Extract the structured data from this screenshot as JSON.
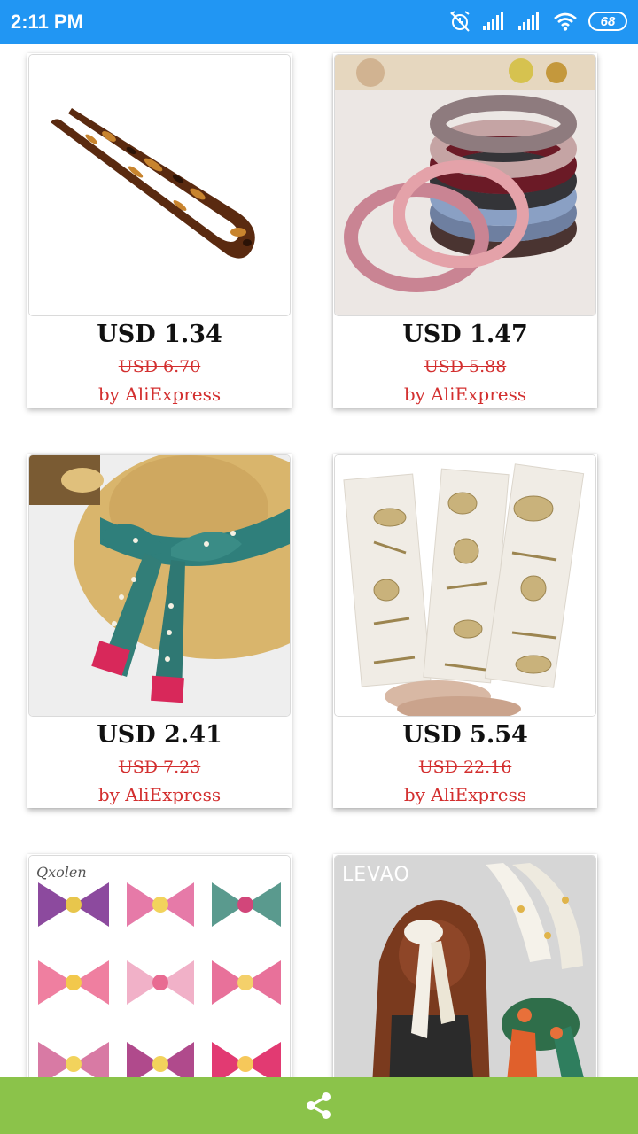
{
  "status_bar": {
    "time": "2:11 PM",
    "battery": "68",
    "background": "#2196f3"
  },
  "products": [
    {
      "image": "tortoiseshell-hair-pin",
      "price": "USD 1.34",
      "original_price": "USD 6.70",
      "seller": "by AliExpress"
    },
    {
      "image": "elastic-hair-ties",
      "price": "USD 1.47",
      "original_price": "USD 5.88",
      "seller": "by AliExpress"
    },
    {
      "image": "hair-scarf-ribbon",
      "price": "USD 2.41",
      "original_price": "USD 7.23",
      "seller": "by AliExpress"
    },
    {
      "image": "rhinestone-hair-clips",
      "price": "USD 5.54",
      "original_price": "USD 22.16",
      "seller": "by AliExpress"
    },
    {
      "image": "hair-bows",
      "price": "",
      "original_price": "",
      "seller": ""
    },
    {
      "image": "scarf-scrunchies",
      "price": "",
      "original_price": "",
      "seller": ""
    }
  ],
  "image_text": {
    "bows_brand": "Qxolen",
    "scrunchie_brand": "LEVAO"
  },
  "bottom_bar": {
    "share_icon": "share-icon",
    "background": "#8bc34a"
  },
  "colors": {
    "price": "#111111",
    "discount": "#d32f2f"
  }
}
